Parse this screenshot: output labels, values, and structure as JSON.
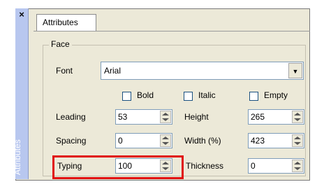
{
  "dock": {
    "title": "Attributes",
    "close_glyph": "×"
  },
  "tab": {
    "label": "Attributes"
  },
  "face": {
    "group_title": "Face",
    "font_label": "Font",
    "font_value": "Arial",
    "bold_label": "Bold",
    "italic_label": "Italic",
    "empty_label": "Empty",
    "leading_label": "Leading",
    "leading_value": "53",
    "height_label": "Height",
    "height_value": "265",
    "spacing_label": "Spacing",
    "spacing_value": "0",
    "width_label": "Width (%)",
    "width_value": "423",
    "typing_label": "Typing",
    "typing_value": "100",
    "thickness_label": "Thickness",
    "thickness_value": "0"
  },
  "colors": {
    "highlight": "#e01010",
    "dock": "#b8c7ef",
    "panel": "#ece9d8"
  },
  "icons": {
    "dock_close": "close-icon",
    "combo": "chevron-down-icon",
    "spinner": "spinner-arrows-icon"
  }
}
